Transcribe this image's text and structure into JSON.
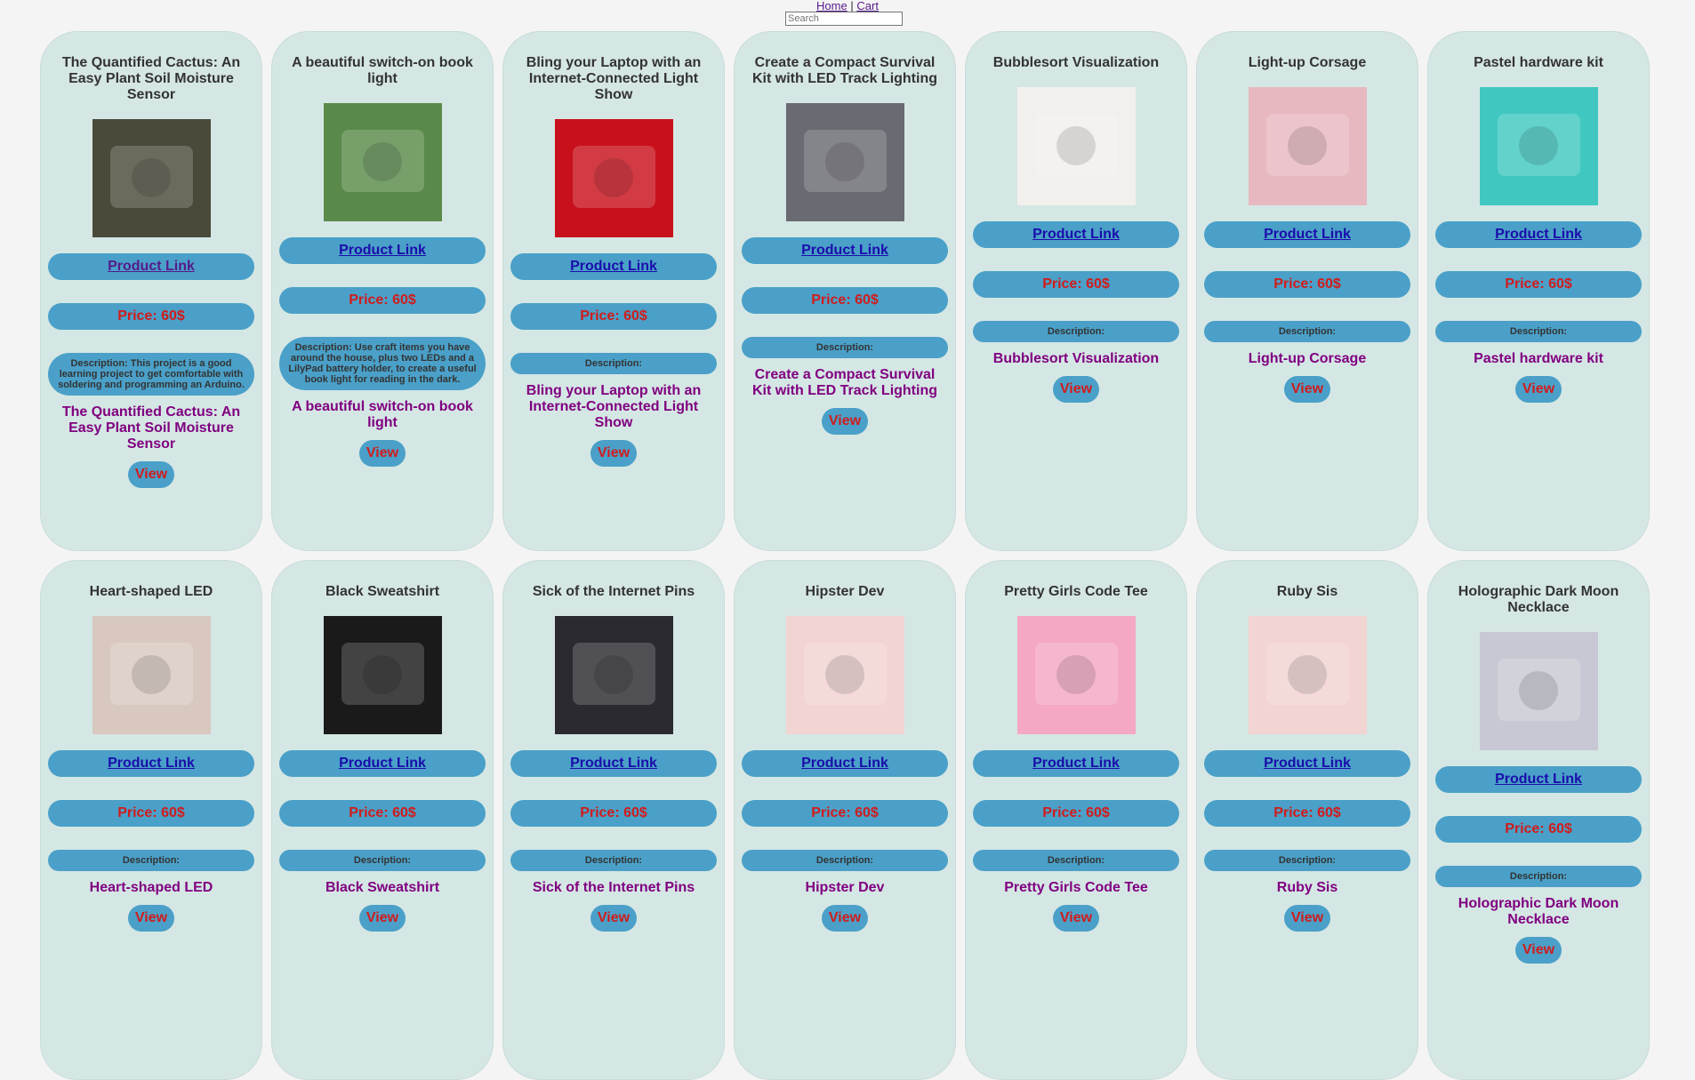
{
  "nav": {
    "home": "Home",
    "sep": "|",
    "cart": "Cart"
  },
  "search": {
    "placeholder": "Search"
  },
  "products": [
    {
      "title": "The Quantified Cactus: An Easy Plant Soil Moisture Sensor",
      "link": "Product Link",
      "price": "Price: 60$",
      "description": "Description: This project is a good learning project to get comfortable with soldering and programming an Arduino.",
      "view": "View",
      "img_color": "#4a4a3a"
    },
    {
      "title": "A beautiful switch-on book light",
      "link": "Product Link",
      "price": "Price: 60$",
      "description": "Description: Use craft items you have around the house, plus two LEDs and a LilyPad battery holder, to create a useful book light for reading in the dark.",
      "view": "View",
      "img_color": "#5a8a4a"
    },
    {
      "title": "Bling your Laptop with an Internet-Connected Light Show",
      "link": "Product Link",
      "price": "Price: 60$",
      "description": "Description:",
      "view": "View",
      "img_color": "#c8101c"
    },
    {
      "title": "Create a Compact Survival Kit with LED Track Lighting",
      "link": "Product Link",
      "price": "Price: 60$",
      "description": "Description:",
      "view": "View",
      "img_color": "#6a6a72"
    },
    {
      "title": "Bubblesort Visualization",
      "link": "Product Link",
      "price": "Price: 60$",
      "description": "Description:",
      "view": "View",
      "img_color": "#f2f0ec"
    },
    {
      "title": "Light-up Corsage",
      "link": "Product Link",
      "price": "Price: 60$",
      "description": "Description:",
      "view": "View",
      "img_color": "#e8b8c0"
    },
    {
      "title": "Pastel hardware kit",
      "link": "Product Link",
      "price": "Price: 60$",
      "description": "Description:",
      "view": "View",
      "img_color": "#40c8c0"
    },
    {
      "title": "Heart-shaped LED",
      "link": "Product Link",
      "price": "Price: 60$",
      "description": "Description:",
      "view": "View",
      "img_color": "#d8c8c0"
    },
    {
      "title": "Black Sweatshirt",
      "link": "Product Link",
      "price": "Price: 60$",
      "description": "Description:",
      "view": "View",
      "img_color": "#1a1a1a"
    },
    {
      "title": "Sick of the Internet Pins",
      "link": "Product Link",
      "price": "Price: 60$",
      "description": "Description:",
      "view": "View",
      "img_color": "#2a2a30"
    },
    {
      "title": "Hipster Dev",
      "link": "Product Link",
      "price": "Price: 60$",
      "description": "Description:",
      "view": "View",
      "img_color": "#f2d4d2"
    },
    {
      "title": "Pretty Girls Code Tee",
      "link": "Product Link",
      "price": "Price: 60$",
      "description": "Description:",
      "view": "View",
      "img_color": "#f4a8c4"
    },
    {
      "title": "Ruby Sis",
      "link": "Product Link",
      "price": "Price: 60$",
      "description": "Description:",
      "view": "View",
      "img_color": "#f2d4d2"
    },
    {
      "title": "Holographic Dark Moon Necklace",
      "link": "Product Link",
      "price": "Price: 60$",
      "description": "Description:",
      "view": "View",
      "img_color": "#c8c8d4"
    }
  ]
}
